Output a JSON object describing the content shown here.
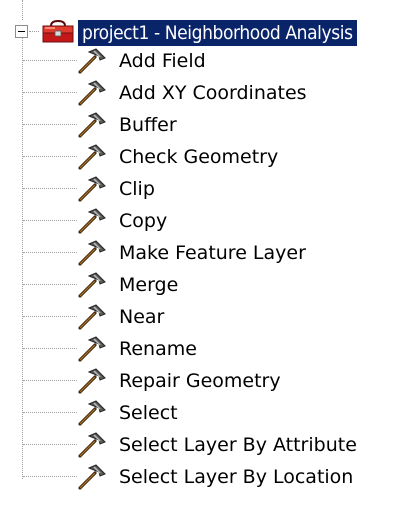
{
  "root": {
    "label": "project1 - Neighborhood Analysis",
    "icon": "toolbox-icon",
    "expanded": true,
    "selected": true
  },
  "colors": {
    "selection_bg": "#0a246a",
    "selection_text": "#ffffff",
    "tree_lines": "#a0a0a0",
    "toolbox_red": "#cc1a1a"
  },
  "tools": [
    {
      "label": "Add Field",
      "icon": "hammer-icon"
    },
    {
      "label": "Add XY Coordinates",
      "icon": "hammer-icon"
    },
    {
      "label": "Buffer",
      "icon": "hammer-icon"
    },
    {
      "label": "Check Geometry",
      "icon": "hammer-icon"
    },
    {
      "label": "Clip",
      "icon": "hammer-icon"
    },
    {
      "label": "Copy",
      "icon": "hammer-icon"
    },
    {
      "label": "Make Feature Layer",
      "icon": "hammer-icon"
    },
    {
      "label": "Merge",
      "icon": "hammer-icon"
    },
    {
      "label": "Near",
      "icon": "hammer-icon"
    },
    {
      "label": "Rename",
      "icon": "hammer-icon"
    },
    {
      "label": "Repair Geometry",
      "icon": "hammer-icon"
    },
    {
      "label": "Select",
      "icon": "hammer-icon"
    },
    {
      "label": "Select Layer By Attribute",
      "icon": "hammer-icon"
    },
    {
      "label": "Select Layer By Location",
      "icon": "hammer-icon"
    }
  ]
}
